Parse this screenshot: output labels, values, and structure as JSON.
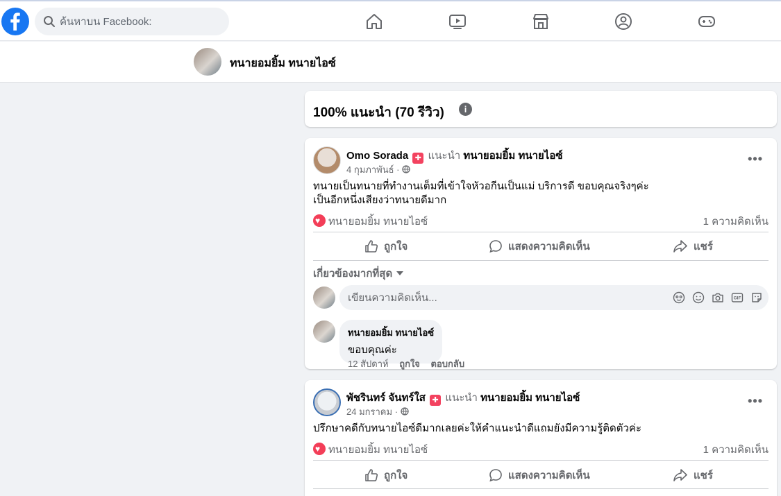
{
  "topbar": {
    "search_placeholder": "ค้นหาบน Facebook:"
  },
  "profile": {
    "name": "ทนายอมยิ้ม ทนายไอซ์"
  },
  "recommendation": {
    "summary": "100% แนะนำ (70 รีวิว)",
    "info_glyph": "i"
  },
  "posts": [
    {
      "author": "Omo Sorada",
      "recommends_word": "แนะนำ",
      "target": "ทนายอมยิ้ม ทนายไอซ์",
      "date": "4 กุมภาพันธ์",
      "body": [
        "ทนายเป็นทนายที่ทำงานเต็มที่เข้าใจหัวอกีนเป็นแม่ บริการดี ขอบคุณจริงๆค่ะ",
        "เป็นอีกหนึ่งเสียงว่าทนายดีมาก"
      ],
      "reaction_by": "ทนายอมยิ้ม ทนายไอซ์",
      "comment_count": "1 ความคิดเห็น",
      "like_label": "ถูกใจ",
      "comment_label": "แสดงความคิดเห็น",
      "share_label": "แชร์",
      "sort_label": "เกี่ยวข้องมากที่สุด",
      "composer_placeholder": "เขียนความคิดเห็น...",
      "reply": {
        "name": "ทนายอมยิ้ม ทนายไอซ์",
        "text": "ขอบคุณค่ะ",
        "time": "12 สัปดาห์",
        "like": "ถูกใจ",
        "reply": "ตอบกลับ"
      }
    },
    {
      "author": "พัชรินทร์ จันทร์ใส",
      "recommends_word": "แนะนำ",
      "target": "ทนายอมยิ้ม ทนายไอซ์",
      "date": "24 มกราคม",
      "body": [
        "ปรึกษาคดีกับทนายไอซ์ดีมากเลยค่ะให้คำแนะนำดีแถมยังมีความรู้ติดตัวค่ะ"
      ],
      "reaction_by": "ทนายอมยิ้ม ทนายไอซ์",
      "comment_count": "1 ความคิดเห็น",
      "like_label": "ถูกใจ",
      "comment_label": "แสดงความคิดเห็น",
      "share_label": "แชร์"
    }
  ],
  "colors": {
    "brand": "#1877f2",
    "reaction": "#f33e58",
    "badge": "#f3425f",
    "muted": "#65676b"
  }
}
